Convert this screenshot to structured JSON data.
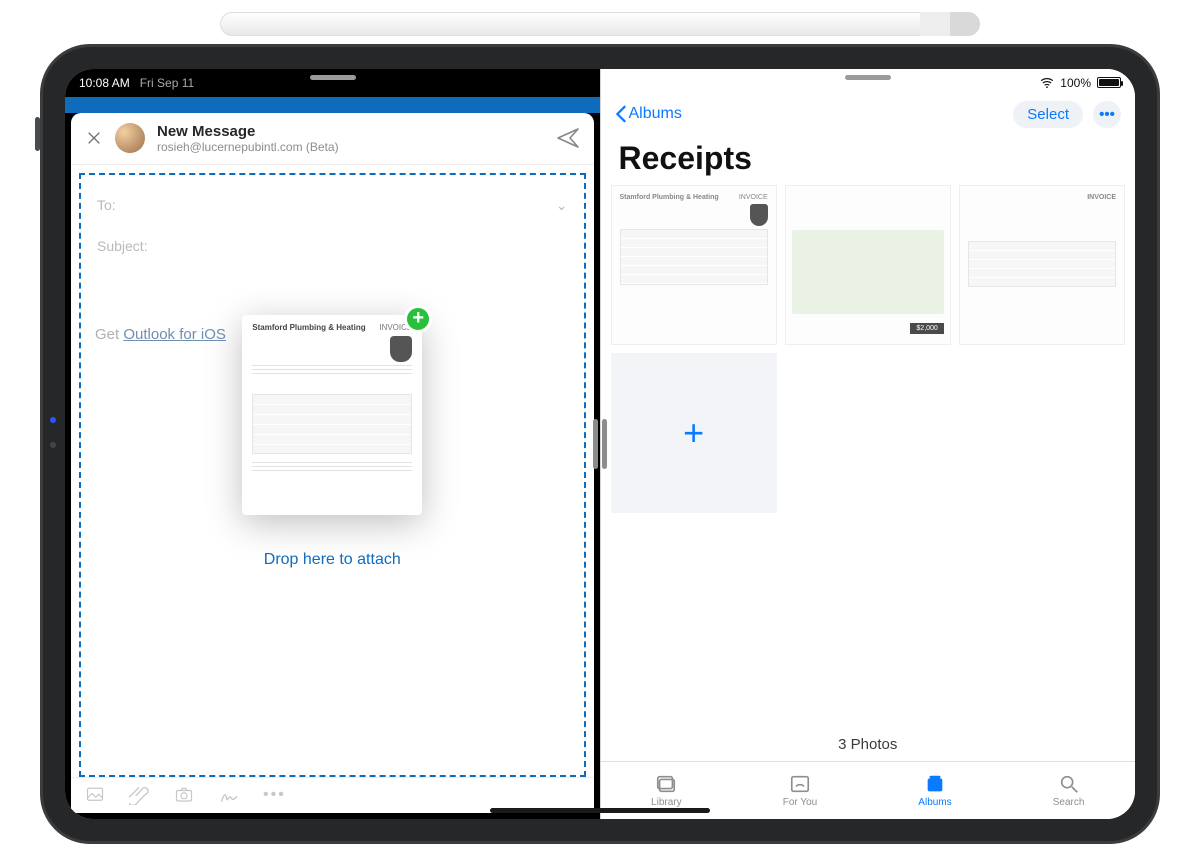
{
  "status": {
    "time": "10:08 AM",
    "date": "Fri Sep 11",
    "battery": "100%"
  },
  "compose": {
    "title": "New Message",
    "sender": "rosieh@lucernepubintl.com (Beta)",
    "to_label": "To:",
    "subject_label": "Subject:",
    "body_prefix": "Get ",
    "body_link": "Outlook for iOS",
    "drop_text": "Drop here to attach",
    "dragging": {
      "company": "Stamford Plumbing & Heating",
      "tag": "INVOICE"
    }
  },
  "photos": {
    "back_label": "Albums",
    "select_label": "Select",
    "album_title": "Receipts",
    "count_label": "3 Photos",
    "thumbs": {
      "receipt1": {
        "company": "Stamford Plumbing & Heating",
        "tag": "INVOICE"
      },
      "receipt2_total": "$2,000",
      "receipt3_tag": "INVOICE"
    },
    "tabs": {
      "library": "Library",
      "foryou": "For You",
      "albums": "Albums",
      "search": "Search"
    }
  }
}
